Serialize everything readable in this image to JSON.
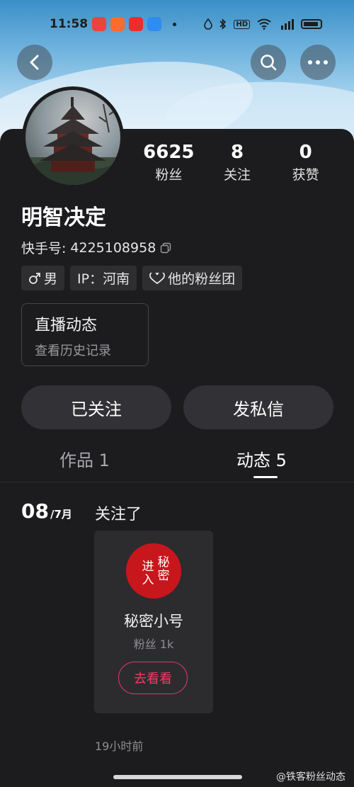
{
  "status_bar": {
    "time": "11:58",
    "right_icons": [
      "droplet-icon",
      "bluetooth-icon",
      "hd-icon",
      "wifi-icon",
      "5g-signal-icon",
      "battery-icon"
    ],
    "hd_label": "HD"
  },
  "header": {
    "back_icon": "back-chevron-icon",
    "search_icon": "search-icon",
    "more_icon": "more-dots-icon"
  },
  "profile": {
    "stats": [
      {
        "value": "6625",
        "label": "粉丝"
      },
      {
        "value": "8",
        "label": "关注"
      },
      {
        "value": "0",
        "label": "获赞"
      }
    ],
    "name": "明智决定",
    "kuaishou_id_label": "快手号:",
    "kuaishou_id": "4225108958",
    "tags": {
      "gender": "男",
      "ip": "IP：河南",
      "fan_group": "他的粉丝团"
    },
    "live": {
      "title": "直播动态",
      "subtitle": "查看历史记录"
    }
  },
  "actions": {
    "followed": "已关注",
    "message": "发私信"
  },
  "tabs": [
    {
      "label": "作品 1",
      "active": false
    },
    {
      "label": "动态 5",
      "active": true
    }
  ],
  "feed": {
    "day": "08",
    "month": "/7月",
    "action": "关注了",
    "card": {
      "seal_left": "秘密",
      "seal_right": "进入",
      "name": "秘密小号",
      "fans": "粉丝 1k",
      "button": "去看看"
    },
    "time": "19小时前"
  },
  "watermark": "@铁客粉丝动态",
  "colors": {
    "background": "#1c1c1e",
    "button_bg": "#323236",
    "accent_pink": "#ee3c62",
    "seal_red": "#c8161d"
  }
}
